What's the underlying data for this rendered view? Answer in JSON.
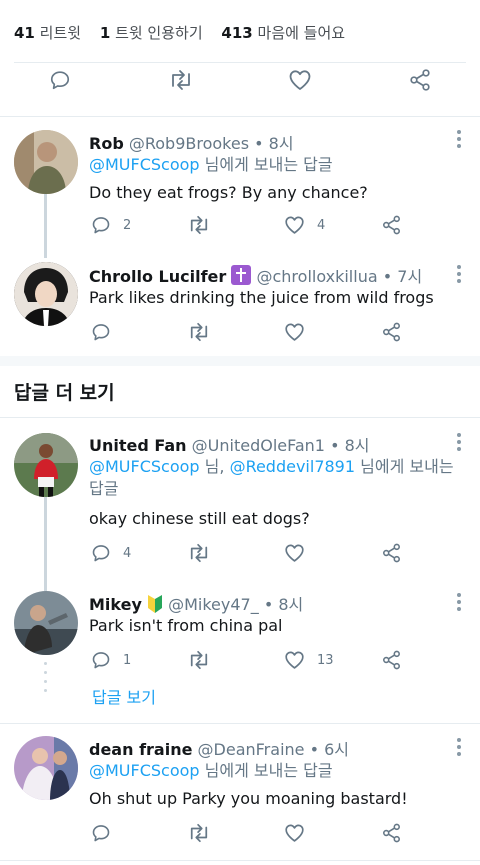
{
  "stats": {
    "retweets_count": "41",
    "retweets_label": "리트윗",
    "quotes_count": "1",
    "quotes_label": "트윗 인용하기",
    "likes_count": "413",
    "likes_label": "마음에 들어요"
  },
  "section_title": "답글 더 보기",
  "view_replies_label": "답글 보기",
  "colors": {
    "link": "#1da1f2",
    "secondary": "#657786",
    "thread_line": "#ccd6dd",
    "divider": "#e6ecf0"
  },
  "tweets": [
    {
      "name": "Rob",
      "handle": "@Rob9Brookes",
      "time": "• 8시",
      "reply_mentions": [
        "@MUFCScoop"
      ],
      "reply_sep": "",
      "reply_suffix": " 님에게 보내는 답글",
      "text": "Do they eat frogs? By any chance?",
      "reply_count": "2",
      "retweet_count": "",
      "like_count": "4"
    },
    {
      "name": "Chrollo Lucilfer",
      "name_emoji": "cross-emoji",
      "handle": "@chrolloxkillua",
      "time": "• 7시",
      "reply_mentions": [],
      "text": "Park likes drinking the juice from wild frogs",
      "reply_count": "",
      "retweet_count": "",
      "like_count": ""
    },
    {
      "name": "United Fan",
      "handle": "@UnitedOleFan1",
      "time": "• 8시",
      "reply_mentions": [
        "@MUFCScoop",
        "@Reddevil7891"
      ],
      "reply_sep": " 님, ",
      "reply_suffix": " 님에게 보내는 답글",
      "text": "okay chinese still eat dogs?",
      "reply_count": "4",
      "retweet_count": "",
      "like_count": ""
    },
    {
      "name": "Mikey",
      "name_emoji": "beginner-emoji",
      "handle": "@Mikey47_",
      "time": "• 8시",
      "reply_mentions": [],
      "text": "Park isn't from china pal",
      "reply_count": "1",
      "retweet_count": "",
      "like_count": "13"
    },
    {
      "name": "dean fraine",
      "handle": "@DeanFraine",
      "time": "• 6시",
      "reply_mentions": [
        "@MUFCScoop"
      ],
      "reply_sep": "",
      "reply_suffix": " 님에게 보내는 답글",
      "text": "Oh shut up Parky you moaning bastard!",
      "reply_count": "",
      "retweet_count": "",
      "like_count": ""
    }
  ]
}
